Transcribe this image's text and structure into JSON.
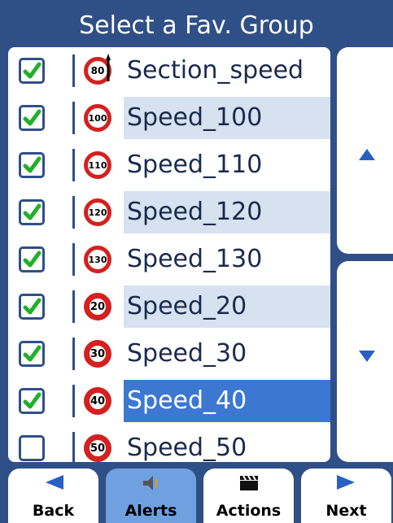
{
  "title": "Select a Fav. Group",
  "items": [
    {
      "label": "Section_speed",
      "sign": "80",
      "sign_style": "section",
      "checked": true
    },
    {
      "label": "Speed_100",
      "sign": "100",
      "sign_style": "thin",
      "checked": true
    },
    {
      "label": "Speed_110",
      "sign": "110",
      "sign_style": "thin",
      "checked": true
    },
    {
      "label": "Speed_120",
      "sign": "120",
      "sign_style": "thin",
      "checked": true
    },
    {
      "label": "Speed_130",
      "sign": "130",
      "sign_style": "thin",
      "checked": true
    },
    {
      "label": "Speed_20",
      "sign": "20",
      "sign_style": "thick",
      "checked": true
    },
    {
      "label": "Speed_30",
      "sign": "30",
      "sign_style": "thick",
      "checked": true
    },
    {
      "label": "Speed_40",
      "sign": "40",
      "sign_style": "thick",
      "checked": true,
      "selected": true
    },
    {
      "label": "Speed_50",
      "sign": "50",
      "sign_style": "thick",
      "checked": false
    }
  ],
  "scroll": {
    "up_icon": "triangle-up-icon",
    "down_icon": "triangle-down-icon"
  },
  "toolbar": {
    "back": "Back",
    "alerts": "Alerts",
    "actions": "Actions",
    "next": "Next",
    "active": "alerts"
  },
  "colors": {
    "background": "#2f4f87",
    "selected_row": "#3c78d2",
    "alt_row": "#d6e2f0",
    "check_green": "#22b02a",
    "sign_red": "#d42020",
    "active_button": "#6fa0e0"
  }
}
